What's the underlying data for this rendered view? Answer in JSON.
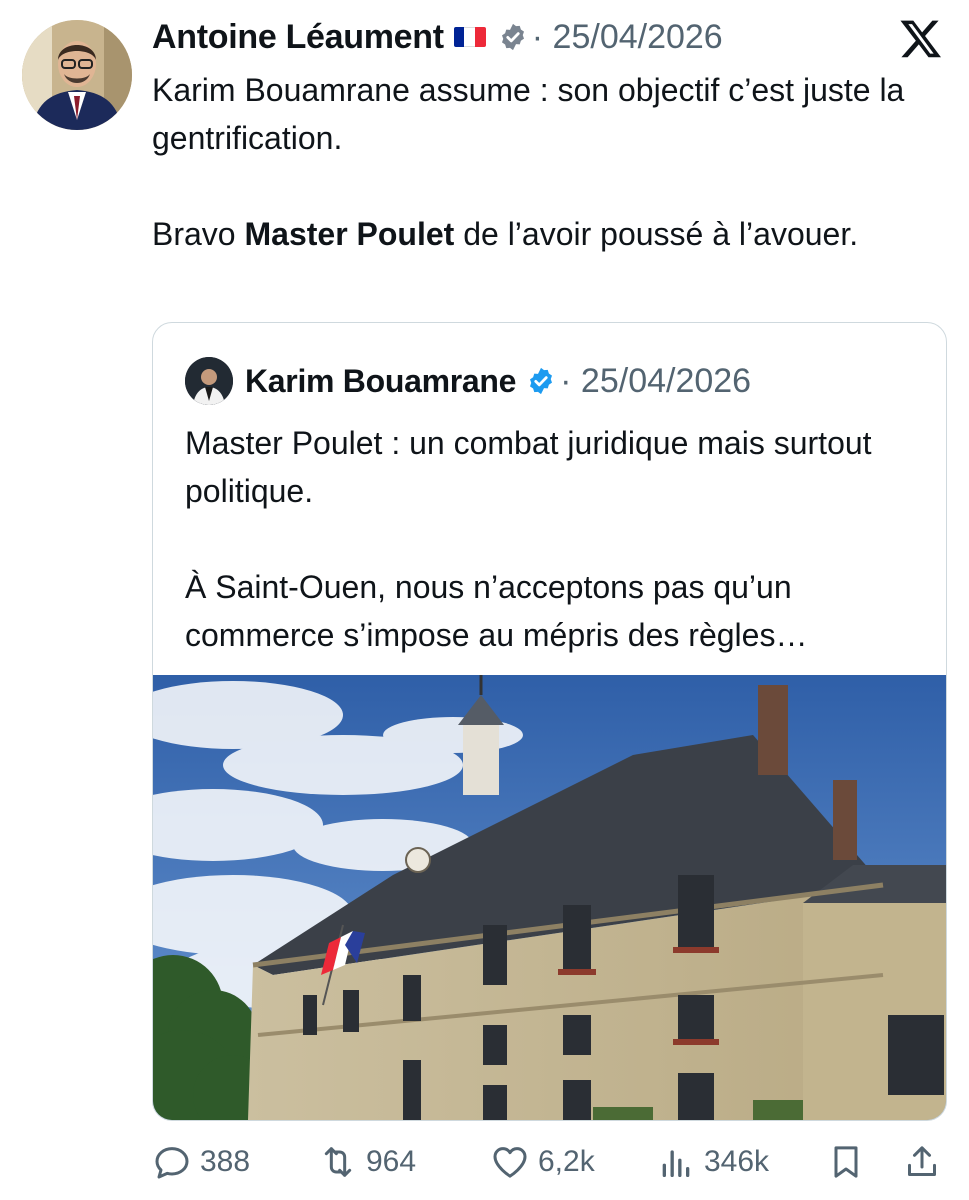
{
  "tweet": {
    "author": "Antoine Léaument",
    "meta": "· 25/04/2026",
    "paragraphs": [
      {
        "pre": "Karim Bouamrane assume : son objectif c’est juste la gentrification.",
        "bold": "",
        "post": ""
      },
      {
        "pre": "Bravo ",
        "bold": "Master Poulet",
        "post": " de l’avoir poussé à l’avouer."
      }
    ]
  },
  "quoted": {
    "author": "Karim Bouamrane",
    "meta": "· 25/04/2026",
    "paragraphs": [
      "Master Poulet : un combat  juridique mais surtout politique.",
      "À Saint-Ouen, nous n’acceptons pas qu’un commerce s’impose au mépris des règles…"
    ]
  },
  "actions": {
    "replies": "388",
    "reposts": "964",
    "likes": "6,2k",
    "views": "346k"
  },
  "icons": {
    "verified": "verified-badge-icon",
    "flag": "french-flag-icon",
    "platform": "x-logo-icon",
    "reply": "reply-icon",
    "repost": "repost-icon",
    "like": "heart-icon",
    "views": "views-icon",
    "bookmark": "bookmark-icon",
    "share": "share-icon"
  },
  "colors": {
    "text": "#0f1419",
    "secondary": "#536471",
    "verified": "#1d9bf0",
    "border": "#cfd9de",
    "flag_blue": "#002395",
    "flag_white": "#ffffff",
    "flag_red": "#ED2939"
  }
}
